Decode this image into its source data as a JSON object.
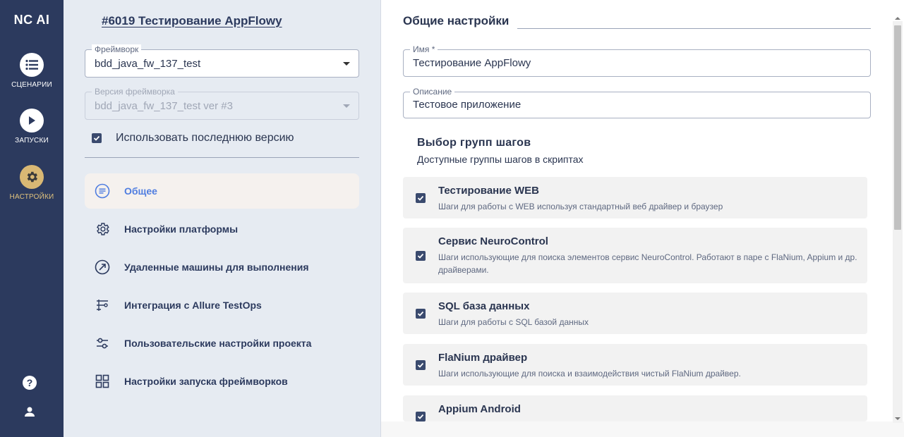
{
  "app": {
    "logo": "NC AI"
  },
  "rail": {
    "items": [
      {
        "label": "СЦЕНАРИИ",
        "icon": "list-icon"
      },
      {
        "label": "ЗАПУСКИ",
        "icon": "play-icon"
      },
      {
        "label": "НАСТРОЙКИ",
        "icon": "gear-icon",
        "active": true
      }
    ],
    "help": "?",
    "user_icon": "user-icon"
  },
  "project": {
    "title": "#6019 Тестирование AppFlowy",
    "framework": {
      "label": "Фреймворк",
      "value": "bdd_java_fw_137_test"
    },
    "framework_version": {
      "label": "Версия фреймворка",
      "value": "bdd_java_fw_137_test ver #3"
    },
    "use_last_version": {
      "label": "Использовать последнюю версию",
      "checked": true
    }
  },
  "menu": {
    "items": [
      {
        "label": "Общее",
        "icon": "list-circle-icon",
        "active": true
      },
      {
        "label": "Настройки платформы",
        "icon": "gear-icon"
      },
      {
        "label": "Удаленные машины для выполнения",
        "icon": "remote-icon"
      },
      {
        "label": "Интеграция с Allure TestOps",
        "icon": "integration-icon"
      },
      {
        "label": "Пользовательские настройки проекта",
        "icon": "sliders-icon"
      },
      {
        "label": "Настройки запуска фреймворков",
        "icon": "grid-icon"
      }
    ]
  },
  "general": {
    "title": "Общие настройки",
    "name": {
      "label": "Имя *",
      "value": "Тестирование AppFlowy"
    },
    "description": {
      "label": "Описание",
      "value": "Тестовое приложение"
    },
    "groups_title": "Выбор групп шагов",
    "groups_subtitle": "Доступные группы шагов в скриптах",
    "groups": [
      {
        "title": "Тестирование WEB",
        "desc": "Шаги для работы с WEB используя стандартный веб драйвер и браузер",
        "checked": true
      },
      {
        "title": "Сервис NeuroControl",
        "desc": "Шаги использующие для поиска элементов сервис NeuroControl. Работают в паре с FlaNium, Appium и др. драйверами.",
        "checked": true
      },
      {
        "title": "SQL база данных",
        "desc": "Шаги для работы с SQL базой данных",
        "checked": true
      },
      {
        "title": "FlaNium драйвер",
        "desc": "Шаги использующие для поиска и взаимодействия чистый FlaNium драйвер.",
        "checked": true
      },
      {
        "title": "Appium Android",
        "desc": "",
        "checked": true
      }
    ]
  },
  "colors": {
    "rail": "#2c3a5e",
    "accent": "#4f7de0",
    "active_icon": "#d9b874"
  }
}
